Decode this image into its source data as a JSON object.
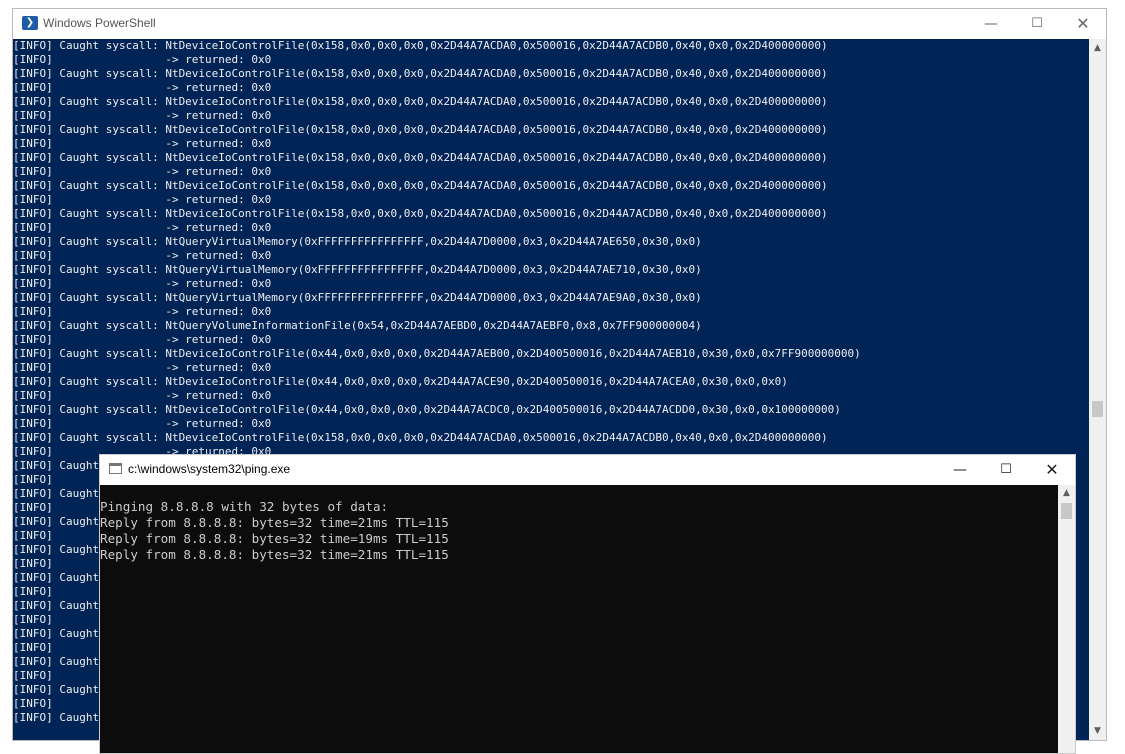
{
  "powershell": {
    "title": "Windows PowerShell",
    "lines": [
      "[INFO] Caught syscall: NtDeviceIoControlFile(0x158,0x0,0x0,0x0,0x2D44A7ACDA0,0x500016,0x2D44A7ACDB0,0x40,0x0,0x2D400000000)",
      "[INFO]                 -> returned: 0x0",
      "[INFO] Caught syscall: NtDeviceIoControlFile(0x158,0x0,0x0,0x0,0x2D44A7ACDA0,0x500016,0x2D44A7ACDB0,0x40,0x0,0x2D400000000)",
      "[INFO]                 -> returned: 0x0",
      "[INFO] Caught syscall: NtDeviceIoControlFile(0x158,0x0,0x0,0x0,0x2D44A7ACDA0,0x500016,0x2D44A7ACDB0,0x40,0x0,0x2D400000000)",
      "[INFO]                 -> returned: 0x0",
      "[INFO] Caught syscall: NtDeviceIoControlFile(0x158,0x0,0x0,0x0,0x2D44A7ACDA0,0x500016,0x2D44A7ACDB0,0x40,0x0,0x2D400000000)",
      "[INFO]                 -> returned: 0x0",
      "[INFO] Caught syscall: NtDeviceIoControlFile(0x158,0x0,0x0,0x0,0x2D44A7ACDA0,0x500016,0x2D44A7ACDB0,0x40,0x0,0x2D400000000)",
      "[INFO]                 -> returned: 0x0",
      "[INFO] Caught syscall: NtDeviceIoControlFile(0x158,0x0,0x0,0x0,0x2D44A7ACDA0,0x500016,0x2D44A7ACDB0,0x40,0x0,0x2D400000000)",
      "[INFO]                 -> returned: 0x0",
      "[INFO] Caught syscall: NtDeviceIoControlFile(0x158,0x0,0x0,0x0,0x2D44A7ACDA0,0x500016,0x2D44A7ACDB0,0x40,0x0,0x2D400000000)",
      "[INFO]                 -> returned: 0x0",
      "[INFO] Caught syscall: NtQueryVirtualMemory(0xFFFFFFFFFFFFFFFF,0x2D44A7D0000,0x3,0x2D44A7AE650,0x30,0x0)",
      "[INFO]                 -> returned: 0x0",
      "[INFO] Caught syscall: NtQueryVirtualMemory(0xFFFFFFFFFFFFFFFF,0x2D44A7D0000,0x3,0x2D44A7AE710,0x30,0x0)",
      "[INFO]                 -> returned: 0x0",
      "[INFO] Caught syscall: NtQueryVirtualMemory(0xFFFFFFFFFFFFFFFF,0x2D44A7D0000,0x3,0x2D44A7AE9A0,0x30,0x0)",
      "[INFO]                 -> returned: 0x0",
      "[INFO] Caught syscall: NtQueryVolumeInformationFile(0x54,0x2D44A7AEBD0,0x2D44A7AEBF0,0x8,0x7FF900000004)",
      "[INFO]                 -> returned: 0x0",
      "[INFO] Caught syscall: NtDeviceIoControlFile(0x44,0x0,0x0,0x0,0x2D44A7AEB00,0x2D400500016,0x2D44A7AEB10,0x30,0x0,0x7FF900000000)",
      "[INFO]                 -> returned: 0x0",
      "[INFO] Caught syscall: NtDeviceIoControlFile(0x44,0x0,0x0,0x0,0x2D44A7ACE90,0x2D400500016,0x2D44A7ACEA0,0x30,0x0,0x0)",
      "[INFO]                 -> returned: 0x0",
      "[INFO] Caught syscall: NtDeviceIoControlFile(0x44,0x0,0x0,0x0,0x2D44A7ACDC0,0x2D400500016,0x2D44A7ACDD0,0x30,0x0,0x100000000)",
      "[INFO]                 -> returned: 0x0",
      "[INFO] Caught syscall: NtDeviceIoControlFile(0x158,0x0,0x0,0x0,0x2D44A7ACDA0,0x500016,0x2D44A7ACDB0,0x40,0x0,0x2D400000000)",
      "[INFO]                 -> returned: 0x0",
      "[INFO] Caught",
      "[INFO]",
      "[INFO] Caught",
      "[INFO]",
      "[INFO] Caught",
      "[INFO]",
      "[INFO] Caught",
      "[INFO]",
      "[INFO] Caught",
      "[INFO]",
      "[INFO] Caught",
      "[INFO]",
      "[INFO] Caught",
      "[INFO]",
      "[INFO] Caught",
      "[INFO]",
      "[INFO] Caught",
      "[INFO]",
      "[INFO] Caught"
    ]
  },
  "ping": {
    "title": "c:\\windows\\system32\\ping.exe",
    "lines": [
      "Pinging 8.8.8.8 with 32 bytes of data:",
      "Reply from 8.8.8.8: bytes=32 time=21ms TTL=115",
      "Reply from 8.8.8.8: bytes=32 time=19ms TTL=115",
      "Reply from 8.8.8.8: bytes=32 time=21ms TTL=115"
    ]
  },
  "icons": {
    "powershell_app": "powershell-icon",
    "console_app": "console-window-icon",
    "minimize": "minimize-icon",
    "maximize": "maximize-icon",
    "close": "close-icon",
    "scroll_up": "scroll-up-arrow-icon",
    "scroll_down": "scroll-down-arrow-icon"
  },
  "colors": {
    "powershell_background": "#012456",
    "powershell_text": "#eeedf0",
    "ping_background": "#0c0c0c",
    "ping_text": "#cccccc"
  }
}
